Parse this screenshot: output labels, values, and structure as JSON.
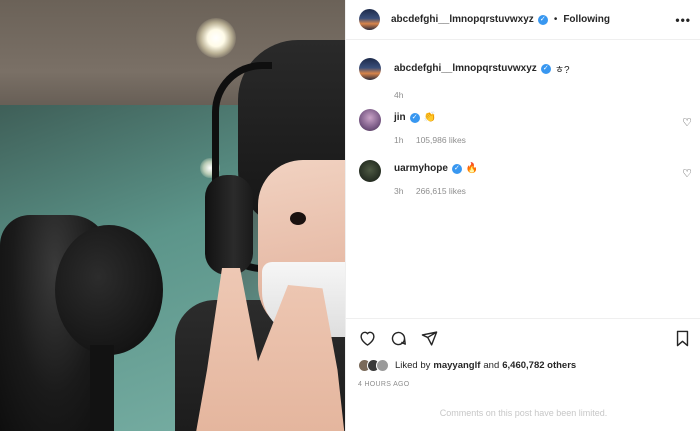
{
  "header": {
    "username": "abcdefghi__lmnopqrstuvwxyz",
    "verified_glyph": "✓",
    "separator": "•",
    "follow_status": "Following",
    "more_icon": "more-horizontal-icon"
  },
  "caption": {
    "username": "abcdefghi__lmnopqrstuvwxyz",
    "text": "ㅎ?",
    "time": "4h"
  },
  "comments": [
    {
      "username": "jin",
      "emoji": "👏",
      "time": "1h",
      "likes": "105,986 likes",
      "avatar_color": "#8a6a9a"
    },
    {
      "username": "uarmyhope",
      "emoji": "🔥",
      "time": "3h",
      "likes": "266,615 likes",
      "avatar_color": "#2f3a2c"
    }
  ],
  "actions": {
    "icons": [
      "heart-icon",
      "comment-icon",
      "share-icon",
      "bookmark-icon"
    ],
    "liked_prefix": "Liked by",
    "liked_user": "mayyanglf",
    "liked_and": "and",
    "liked_count": "6,460,782 others",
    "timestamp": "4 HOURS AGO",
    "limited_notice": "Comments on this post have been limited."
  },
  "colors": {
    "verified": "#3897f0",
    "text": "#262626",
    "muted": "#8e8e8e",
    "border": "#efefef"
  }
}
